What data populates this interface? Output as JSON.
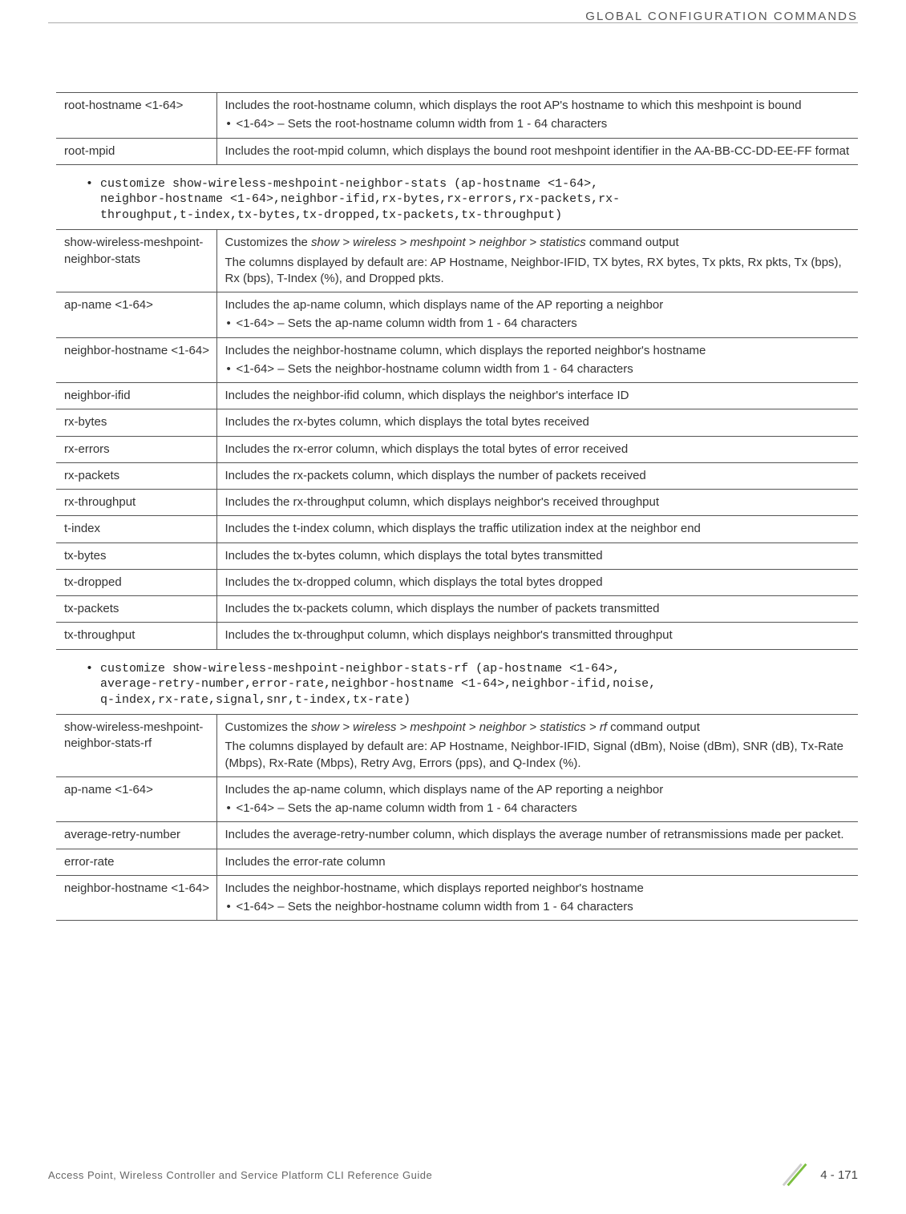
{
  "header": {
    "title": "GLOBAL CONFIGURATION COMMANDS"
  },
  "table1": {
    "rows": [
      {
        "left": "root-hostname <1-64>",
        "right_main": "Includes the root-hostname column, which displays the root AP's hostname to which this meshpoint is bound",
        "right_bullet": "<1-64> – Sets the root-hostname column width from 1 - 64 characters"
      },
      {
        "left": "root-mpid",
        "right_main": "Includes the root-mpid column, which displays the bound root meshpoint identifier in the AA-BB-CC-DD-EE-FF format"
      }
    ]
  },
  "code1": "• customize show-wireless-meshpoint-neighbor-stats (ap-hostname <1-64>,\nneighbor-hostname <1-64>,neighbor-ifid,rx-bytes,rx-errors,rx-packets,rx-\nthroughput,t-index,tx-bytes,tx-dropped,tx-packets,tx-throughput)",
  "table2": {
    "rows": [
      {
        "left": "show-wireless-meshpoint-neighbor-stats",
        "right_lead": "Customizes the ",
        "right_italic": "show > wireless > meshpoint > neighbor > statistics",
        "right_tail": " command output",
        "right_p2": "The columns displayed by default are: AP Hostname, Neighbor-IFID, TX bytes, RX bytes, Tx pkts, Rx pkts, Tx (bps), Rx (bps), T-Index (%), and Dropped pkts."
      },
      {
        "left": "ap-name <1-64>",
        "right_main": "Includes the ap-name column, which displays name of the AP reporting a neighbor",
        "right_bullet": "<1-64> – Sets the ap-name column width from 1 - 64 characters"
      },
      {
        "left": "neighbor-hostname <1-64>",
        "right_main": "Includes the neighbor-hostname column, which displays the reported neighbor's hostname",
        "right_bullet": "<1-64> – Sets the neighbor-hostname column width from 1 - 64 characters"
      },
      {
        "left": "neighbor-ifid",
        "right_main": "Includes the neighbor-ifid column, which displays the neighbor's interface ID"
      },
      {
        "left": "rx-bytes",
        "right_main": "Includes the rx-bytes column, which displays the total bytes received"
      },
      {
        "left": "rx-errors",
        "right_main": "Includes the rx-error column, which displays the total bytes of error received"
      },
      {
        "left": "rx-packets",
        "right_main": "Includes the rx-packets column, which displays the number of packets received"
      },
      {
        "left": "rx-throughput",
        "right_main": "Includes the rx-throughput column, which displays neighbor's received throughput"
      },
      {
        "left": "t-index",
        "right_main": "Includes the t-index column, which displays the traffic utilization index at the neighbor end"
      },
      {
        "left": "tx-bytes",
        "right_main": "Includes the tx-bytes column, which displays the total bytes transmitted"
      },
      {
        "left": "tx-dropped",
        "right_main": "Includes the tx-dropped column, which displays the total bytes dropped"
      },
      {
        "left": "tx-packets",
        "right_main": "Includes the tx-packets column, which displays the number of packets transmitted"
      },
      {
        "left": "tx-throughput",
        "right_main": "Includes the tx-throughput column, which displays neighbor's transmitted throughput"
      }
    ]
  },
  "code2": "• customize show-wireless-meshpoint-neighbor-stats-rf (ap-hostname <1-64>,\naverage-retry-number,error-rate,neighbor-hostname <1-64>,neighbor-ifid,noise,\nq-index,rx-rate,signal,snr,t-index,tx-rate)",
  "table3": {
    "rows": [
      {
        "left": "show-wireless-meshpoint-neighbor-stats-rf",
        "right_lead": "Customizes the ",
        "right_italic": "show > wireless > meshpoint > neighbor > statistics > rf",
        "right_tail": " command output",
        "right_p2": "The columns displayed by default are: AP Hostname, Neighbor-IFID, Signal (dBm), Noise (dBm), SNR (dB), Tx-Rate (Mbps), Rx-Rate (Mbps), Retry Avg, Errors (pps), and Q-Index (%)."
      },
      {
        "left": "ap-name <1-64>",
        "right_main": "Includes the ap-name column, which displays name of the AP reporting a neighbor",
        "right_bullet": "<1-64> – Sets the ap-name column width from 1 - 64 characters"
      },
      {
        "left": "average-retry-number",
        "right_main": "Includes the average-retry-number column, which displays the average number of retransmissions made per packet."
      },
      {
        "left": "error-rate",
        "right_main": "Includes the error-rate column"
      },
      {
        "left": "neighbor-hostname <1-64>",
        "right_main": "Includes the neighbor-hostname, which displays reported neighbor's hostname",
        "right_bullet": "<1-64> – Sets the neighbor-hostname column width from 1 - 64 characters"
      }
    ]
  },
  "footer": {
    "text": "Access Point, Wireless Controller and Service Platform CLI Reference Guide",
    "page": "4 - 171"
  }
}
